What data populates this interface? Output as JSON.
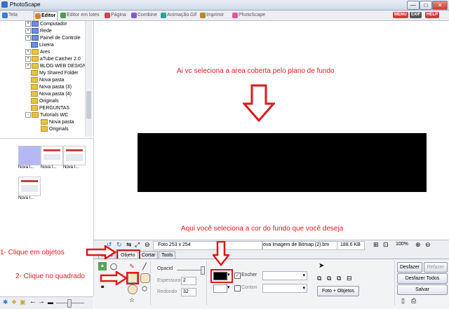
{
  "window": {
    "title": "PhotoScape",
    "controls": [
      "—",
      "□",
      "✕"
    ]
  },
  "tabs": [
    {
      "label": "Tela",
      "icon": "home-icon",
      "color": "#3b7dd8"
    },
    {
      "label": "Editor",
      "icon": "editor-icon",
      "color": "#d9822b",
      "active": true
    },
    {
      "label": "Editor em lotes",
      "icon": "batch-editor-icon",
      "color": "#4c9f4c"
    },
    {
      "label": "Página",
      "icon": "page-icon",
      "color": "#c94a4a"
    },
    {
      "label": "Combine",
      "icon": "combine-icon",
      "color": "#8a5bc7"
    },
    {
      "label": "Animação Gif",
      "icon": "gif-animation-icon",
      "color": "#2f9f9f"
    },
    {
      "label": "Imprimir",
      "icon": "printer-icon",
      "color": "#b8892c"
    },
    {
      "label": "PhotoScape",
      "icon": "photoscape-icon",
      "color": "#d65a9a"
    }
  ],
  "header_badges": [
    {
      "label": "MENU",
      "color": "#d23b3b"
    },
    {
      "label": "EXIF",
      "color": "#555555"
    },
    {
      "label": "HELP",
      "color": "#d23b3b"
    }
  ],
  "folder_tree": [
    {
      "label": "Computador",
      "expander": "+",
      "indent": 1,
      "folder": "blue"
    },
    {
      "label": "Rede",
      "expander": "+",
      "indent": 1,
      "folder": "blue"
    },
    {
      "label": "Painel de Controle",
      "expander": "+",
      "indent": 1,
      "folder": "blue"
    },
    {
      "label": "Lixeira",
      "expander": "",
      "indent": 1,
      "folder": "blue"
    },
    {
      "label": "Ares",
      "expander": "+",
      "indent": 1,
      "folder": "yellow"
    },
    {
      "label": "aTube Catcher 2.0",
      "expander": "+",
      "indent": 1,
      "folder": "yellow"
    },
    {
      "label": "BLOG WEB DESIGN",
      "expander": "+",
      "indent": 1,
      "folder": "yellow"
    },
    {
      "label": "My Shared Folder",
      "expander": "",
      "indent": 1,
      "folder": "yellow"
    },
    {
      "label": "Nova pasta",
      "expander": "",
      "indent": 1,
      "folder": "yellow"
    },
    {
      "label": "Nova pasta (3)",
      "expander": "",
      "indent": 1,
      "folder": "yellow"
    },
    {
      "label": "Nova pasta (4)",
      "expander": "",
      "indent": 1,
      "folder": "yellow"
    },
    {
      "label": "Originals",
      "expander": "",
      "indent": 1,
      "folder": "yellow"
    },
    {
      "label": "PERGUNTAS",
      "expander": "",
      "indent": 1,
      "folder": "yellow"
    },
    {
      "label": "Tutorials WC",
      "expander": "-",
      "indent": 1,
      "folder": "yellow"
    },
    {
      "label": "Nova pasta",
      "expander": "",
      "indent": 2,
      "folder": "yellow"
    },
    {
      "label": "Originals",
      "expander": "",
      "indent": 2,
      "folder": "yellow"
    }
  ],
  "thumbnails": [
    {
      "caption": "Nova I...",
      "selected": true
    },
    {
      "caption": "Nova I...",
      "selected": false
    },
    {
      "caption": "Nova I...",
      "selected": false
    },
    {
      "caption": "Nova I...",
      "selected": false
    }
  ],
  "canvas": {
    "annotation_top": "Ai vc seleciona a area coberta pelo plano de fundo",
    "annotation_bottom": "Aqui você seleciona a cor do fundo que você deseja",
    "rectangle_fill": "#000000"
  },
  "statusbar": {
    "photo_size": "Foto 253 x 254",
    "filename": "ova Imagem de Bitmap (2).bm",
    "filesize": "188.6 KB",
    "zoom": "100%"
  },
  "bottom_tabs": [
    {
      "label": "Início",
      "active": false
    },
    {
      "label": "Objeto",
      "active": true
    },
    {
      "label": "Cortar",
      "active": false
    },
    {
      "label": "Tools",
      "active": false
    }
  ],
  "left_annotations": {
    "step1": "1- Clique em objetos",
    "step2": "2- Clique no quadrado"
  },
  "object_panel": {
    "opacity_label": "Opacid",
    "opacity_value": 1.0,
    "thickness_label": "Espessura",
    "thickness_value": "2",
    "rounded_label": "Redondo",
    "rounded_value": "32",
    "fill_label": "Encher",
    "fill_checked": true,
    "outline_label": "Conton",
    "outline_checked": false,
    "color_swatch": "#000000",
    "photo_objects_button": "Foto + Objetos"
  },
  "action_buttons": {
    "undo": "Desfazer",
    "redo": "Refazer",
    "undo_all": "Desfazer Todos",
    "save": "Salvar"
  },
  "accent_red": "#e01818"
}
